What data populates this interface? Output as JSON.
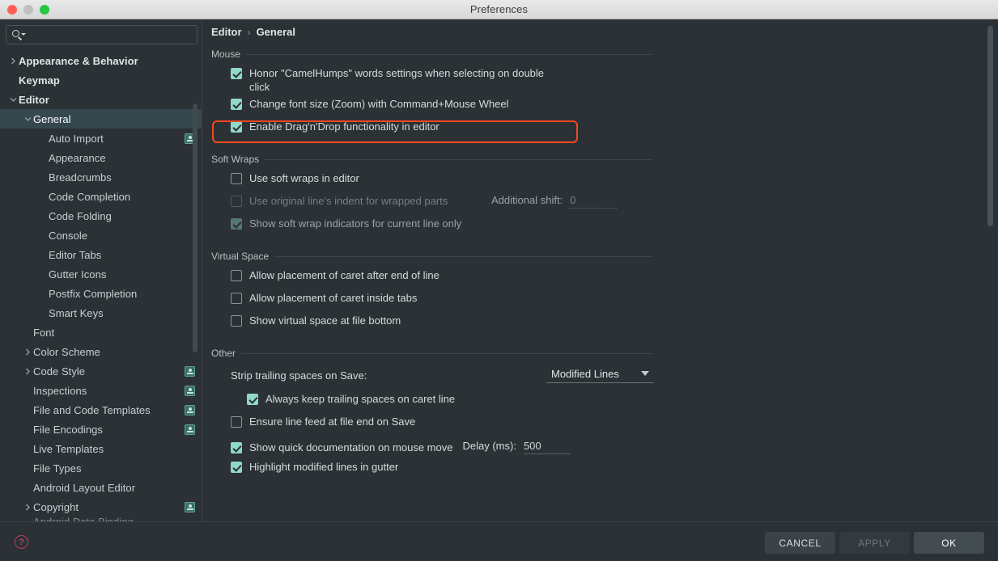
{
  "window": {
    "title": "Preferences",
    "controls": [
      "close",
      "minimize",
      "zoom"
    ]
  },
  "sidebar": {
    "search": {
      "value": "",
      "placeholder": ""
    },
    "items": [
      {
        "label": "Appearance & Behavior",
        "indent": 0,
        "arrow": "right",
        "bold": true,
        "cfg": false,
        "selected": false
      },
      {
        "label": "Keymap",
        "indent": 0,
        "arrow": "none",
        "bold": true,
        "cfg": false,
        "selected": false
      },
      {
        "label": "Editor",
        "indent": 0,
        "arrow": "down",
        "bold": true,
        "cfg": false,
        "selected": false
      },
      {
        "label": "General",
        "indent": 1,
        "arrow": "down",
        "bold": false,
        "cfg": false,
        "selected": true
      },
      {
        "label": "Auto Import",
        "indent": 2,
        "arrow": "none",
        "bold": false,
        "cfg": true,
        "selected": false
      },
      {
        "label": "Appearance",
        "indent": 2,
        "arrow": "none",
        "bold": false,
        "cfg": false,
        "selected": false
      },
      {
        "label": "Breadcrumbs",
        "indent": 2,
        "arrow": "none",
        "bold": false,
        "cfg": false,
        "selected": false
      },
      {
        "label": "Code Completion",
        "indent": 2,
        "arrow": "none",
        "bold": false,
        "cfg": false,
        "selected": false
      },
      {
        "label": "Code Folding",
        "indent": 2,
        "arrow": "none",
        "bold": false,
        "cfg": false,
        "selected": false
      },
      {
        "label": "Console",
        "indent": 2,
        "arrow": "none",
        "bold": false,
        "cfg": false,
        "selected": false
      },
      {
        "label": "Editor Tabs",
        "indent": 2,
        "arrow": "none",
        "bold": false,
        "cfg": false,
        "selected": false
      },
      {
        "label": "Gutter Icons",
        "indent": 2,
        "arrow": "none",
        "bold": false,
        "cfg": false,
        "selected": false
      },
      {
        "label": "Postfix Completion",
        "indent": 2,
        "arrow": "none",
        "bold": false,
        "cfg": false,
        "selected": false
      },
      {
        "label": "Smart Keys",
        "indent": 2,
        "arrow": "none",
        "bold": false,
        "cfg": false,
        "selected": false
      },
      {
        "label": "Font",
        "indent": 1,
        "arrow": "none",
        "bold": false,
        "cfg": false,
        "selected": false
      },
      {
        "label": "Color Scheme",
        "indent": 1,
        "arrow": "right",
        "bold": false,
        "cfg": false,
        "selected": false
      },
      {
        "label": "Code Style",
        "indent": 1,
        "arrow": "right",
        "bold": false,
        "cfg": true,
        "selected": false
      },
      {
        "label": "Inspections",
        "indent": 1,
        "arrow": "none",
        "bold": false,
        "cfg": true,
        "selected": false
      },
      {
        "label": "File and Code Templates",
        "indent": 1,
        "arrow": "none",
        "bold": false,
        "cfg": true,
        "selected": false
      },
      {
        "label": "File Encodings",
        "indent": 1,
        "arrow": "none",
        "bold": false,
        "cfg": true,
        "selected": false
      },
      {
        "label": "Live Templates",
        "indent": 1,
        "arrow": "none",
        "bold": false,
        "cfg": false,
        "selected": false
      },
      {
        "label": "File Types",
        "indent": 1,
        "arrow": "none",
        "bold": false,
        "cfg": false,
        "selected": false
      },
      {
        "label": "Android Layout Editor",
        "indent": 1,
        "arrow": "none",
        "bold": false,
        "cfg": false,
        "selected": false
      },
      {
        "label": "Copyright",
        "indent": 1,
        "arrow": "right",
        "bold": false,
        "cfg": true,
        "selected": false
      },
      {
        "label": "Android Data Binding",
        "indent": 1,
        "arrow": "none",
        "bold": false,
        "cfg": false,
        "selected": false,
        "clipped": true
      }
    ]
  },
  "breadcrumb": {
    "root": "Editor",
    "separator": "›",
    "leaf": "General"
  },
  "sections": {
    "mouse": {
      "title": "Mouse",
      "options": [
        {
          "label": "Honor \"CamelHumps\" words settings when selecting on double click",
          "checked": true,
          "enabled": true,
          "highlighted": false
        },
        {
          "label": "Change font size (Zoom) with Command+Mouse Wheel",
          "checked": true,
          "enabled": true,
          "highlighted": true
        },
        {
          "label": "Enable Drag'n'Drop functionality in editor",
          "checked": true,
          "enabled": true,
          "highlighted": false
        }
      ]
    },
    "soft_wraps": {
      "title": "Soft Wraps",
      "options": [
        {
          "label": "Use soft wraps in editor",
          "checked": false,
          "enabled": true,
          "highlighted": false
        },
        {
          "label": "Use original line's indent for wrapped parts",
          "checked": false,
          "enabled": false,
          "highlighted": false
        },
        {
          "label": "Show soft wrap indicators for current line only",
          "checked": true,
          "enabled": false,
          "highlighted": false
        }
      ],
      "additional_shift": {
        "label": "Additional shift:",
        "value": "0",
        "enabled": false
      }
    },
    "virtual_space": {
      "title": "Virtual Space",
      "options": [
        {
          "label": "Allow placement of caret after end of line",
          "checked": false,
          "enabled": true,
          "highlighted": false
        },
        {
          "label": "Allow placement of caret inside tabs",
          "checked": false,
          "enabled": true,
          "highlighted": false
        },
        {
          "label": "Show virtual space at file bottom",
          "checked": false,
          "enabled": true,
          "highlighted": false
        }
      ]
    },
    "other": {
      "title": "Other",
      "strip_trailing": {
        "label": "Strip trailing spaces on Save:",
        "selected": "Modified Lines"
      },
      "options": [
        {
          "label": "Always keep trailing spaces on caret line",
          "checked": true,
          "enabled": true,
          "highlighted": false
        },
        {
          "label": "Ensure line feed at file end on Save",
          "checked": false,
          "enabled": true,
          "highlighted": false
        },
        {
          "label": "Show quick documentation on mouse move",
          "checked": true,
          "enabled": true,
          "highlighted": false
        },
        {
          "label": "Highlight modified lines in gutter",
          "checked": true,
          "enabled": true,
          "highlighted": false
        }
      ],
      "delay": {
        "label": "Delay (ms):",
        "value": "500"
      }
    }
  },
  "footer": {
    "help_glyph": "?",
    "cancel_label": "CANCEL",
    "apply_label": "APPLY",
    "ok_label": "OK"
  },
  "colors": {
    "background": "#2b3135",
    "selection": "#34484e",
    "accent_checkbox": "#8fd8cb",
    "highlight_box": "#f24822",
    "help_icon": "#c0396b",
    "config_badge": "#5ea396"
  }
}
